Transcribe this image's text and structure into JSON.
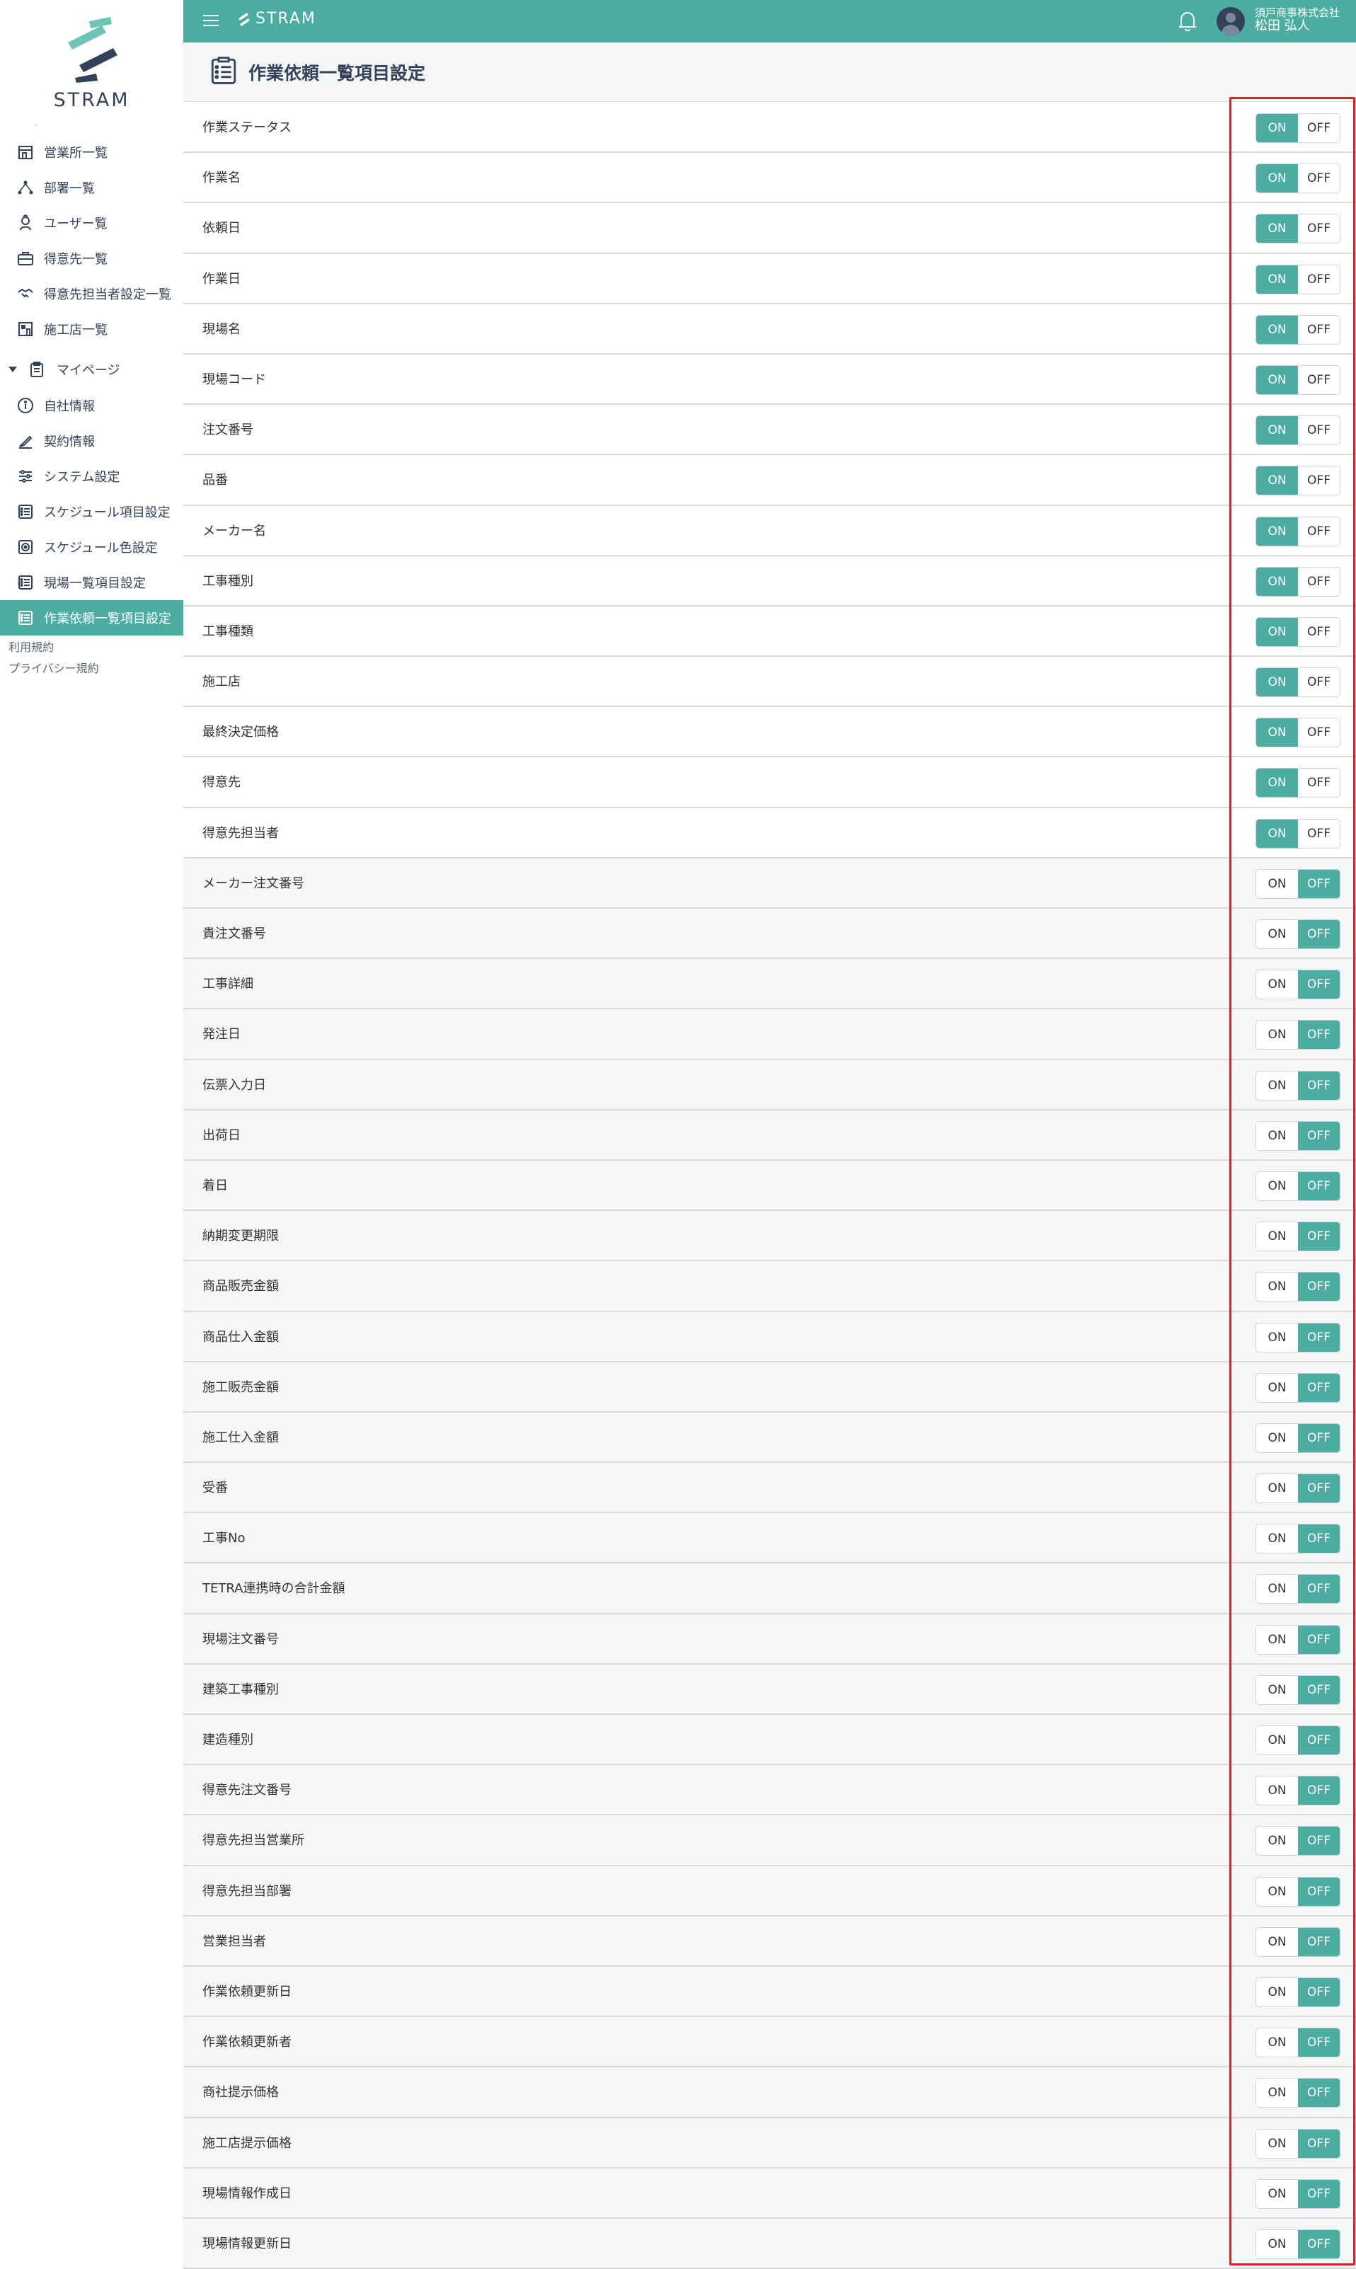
{
  "sidebar": {
    "logo_text": "STRAM",
    "items": [
      {
        "label": "営業所一覧",
        "icon": "store-icon"
      },
      {
        "label": "部署一覧",
        "icon": "hierarchy-icon"
      },
      {
        "label": "ユーザー覧",
        "icon": "user-icon"
      },
      {
        "label": "得意先一覧",
        "icon": "briefcase-icon"
      },
      {
        "label": "得意先担当者設定一覧",
        "icon": "handshake-icon"
      },
      {
        "label": "施工店一覧",
        "icon": "building-icon"
      }
    ],
    "mypage": {
      "label": "マイページ",
      "icon": "clipboard-icon"
    },
    "mypage_items": [
      {
        "label": "自社情報",
        "icon": "info-icon"
      },
      {
        "label": "契約情報",
        "icon": "pen-icon"
      },
      {
        "label": "システム設定",
        "icon": "sliders-icon"
      },
      {
        "label": "スケジュール項目設定",
        "icon": "list-icon"
      },
      {
        "label": "スケジュール色設定",
        "icon": "palette-icon"
      },
      {
        "label": "現場一覧項目設定",
        "icon": "list-icon"
      },
      {
        "label": "作業依頼一覧項目設定",
        "icon": "list-icon"
      }
    ],
    "footer_links": [
      "利用規約",
      "プライバシー規約"
    ]
  },
  "topbar": {
    "brand": "STRAM",
    "company": "須戸商事株式会社",
    "user_name": "松田 弘人"
  },
  "page": {
    "title": "作業依頼一覧項目設定"
  },
  "toggle_labels": {
    "on": "ON",
    "off": "OFF"
  },
  "colors": {
    "accent": "#4bada0",
    "navy": "#33425b",
    "highlight": "#e02020"
  },
  "fields": [
    {
      "label": "作業ステータス",
      "state": "ON"
    },
    {
      "label": "作業名",
      "state": "ON"
    },
    {
      "label": "依頼日",
      "state": "ON"
    },
    {
      "label": "作業日",
      "state": "ON"
    },
    {
      "label": "現場名",
      "state": "ON"
    },
    {
      "label": "現場コード",
      "state": "ON"
    },
    {
      "label": "注文番号",
      "state": "ON"
    },
    {
      "label": "品番",
      "state": "ON"
    },
    {
      "label": "メーカー名",
      "state": "ON"
    },
    {
      "label": "工事種別",
      "state": "ON"
    },
    {
      "label": "工事種類",
      "state": "ON"
    },
    {
      "label": "施工店",
      "state": "ON"
    },
    {
      "label": "最終決定価格",
      "state": "ON"
    },
    {
      "label": "得意先",
      "state": "ON"
    },
    {
      "label": "得意先担当者",
      "state": "ON"
    },
    {
      "label": "メーカー注文番号",
      "state": "OFF"
    },
    {
      "label": "貴注文番号",
      "state": "OFF"
    },
    {
      "label": "工事詳細",
      "state": "OFF"
    },
    {
      "label": "発注日",
      "state": "OFF"
    },
    {
      "label": "伝票入力日",
      "state": "OFF"
    },
    {
      "label": "出荷日",
      "state": "OFF"
    },
    {
      "label": "着日",
      "state": "OFF"
    },
    {
      "label": "納期変更期限",
      "state": "OFF"
    },
    {
      "label": "商品販売金額",
      "state": "OFF"
    },
    {
      "label": "商品仕入金額",
      "state": "OFF"
    },
    {
      "label": "施工販売金額",
      "state": "OFF"
    },
    {
      "label": "施工仕入金額",
      "state": "OFF"
    },
    {
      "label": "受番",
      "state": "OFF"
    },
    {
      "label": "工事No",
      "state": "OFF"
    },
    {
      "label": "TETRA連携時の合計金額",
      "state": "OFF"
    },
    {
      "label": "現場注文番号",
      "state": "OFF"
    },
    {
      "label": "建築工事種別",
      "state": "OFF"
    },
    {
      "label": "建造種別",
      "state": "OFF"
    },
    {
      "label": "得意先注文番号",
      "state": "OFF"
    },
    {
      "label": "得意先担当営業所",
      "state": "OFF"
    },
    {
      "label": "得意先担当部署",
      "state": "OFF"
    },
    {
      "label": "営業担当者",
      "state": "OFF"
    },
    {
      "label": "作業依頼更新日",
      "state": "OFF"
    },
    {
      "label": "作業依頼更新者",
      "state": "OFF"
    },
    {
      "label": "商社提示価格",
      "state": "OFF"
    },
    {
      "label": "施工店提示価格",
      "state": "OFF"
    },
    {
      "label": "現場情報作成日",
      "state": "OFF"
    },
    {
      "label": "現場情報更新日",
      "state": "OFF"
    }
  ]
}
